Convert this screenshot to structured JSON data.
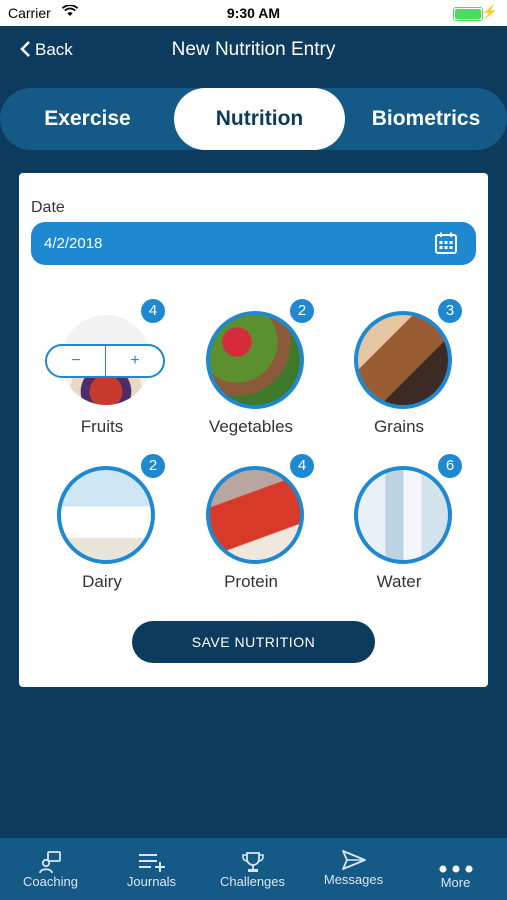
{
  "status_bar": {
    "carrier": "Carrier",
    "time": "9:30 AM"
  },
  "navbar": {
    "back_label": "Back",
    "title": "New Nutrition Entry"
  },
  "segments": [
    {
      "label": "Exercise",
      "selected": false
    },
    {
      "label": "Nutrition",
      "selected": true
    },
    {
      "label": "Biometrics",
      "selected": false
    }
  ],
  "form": {
    "date_label": "Date",
    "date_value": "4/2/2018",
    "foods": [
      {
        "name": "Fruits",
        "count": "4",
        "icon": "fruits-image",
        "stepper": {
          "minus": "−",
          "plus": "+"
        }
      },
      {
        "name": "Vegetables",
        "count": "2",
        "icon": "vegetables-image"
      },
      {
        "name": "Grains",
        "count": "3",
        "icon": "grains-image"
      },
      {
        "name": "Dairy",
        "count": "2",
        "icon": "dairy-image"
      },
      {
        "name": "Protein",
        "count": "4",
        "icon": "protein-image"
      },
      {
        "name": "Water",
        "count": "6",
        "icon": "water-image"
      }
    ],
    "save_label": "SAVE NUTRITION"
  },
  "tabbar": [
    {
      "label": "Coaching",
      "icon": "coaching-icon"
    },
    {
      "label": "Journals",
      "icon": "journals-icon"
    },
    {
      "label": "Challenges",
      "icon": "trophy-icon"
    },
    {
      "label": "Messages",
      "icon": "send-icon"
    },
    {
      "label": "More",
      "icon": "more-icon"
    }
  ],
  "colors": {
    "background": "#0d3b5e",
    "accent": "#1e88d0",
    "tab_bar": "#155a86"
  }
}
